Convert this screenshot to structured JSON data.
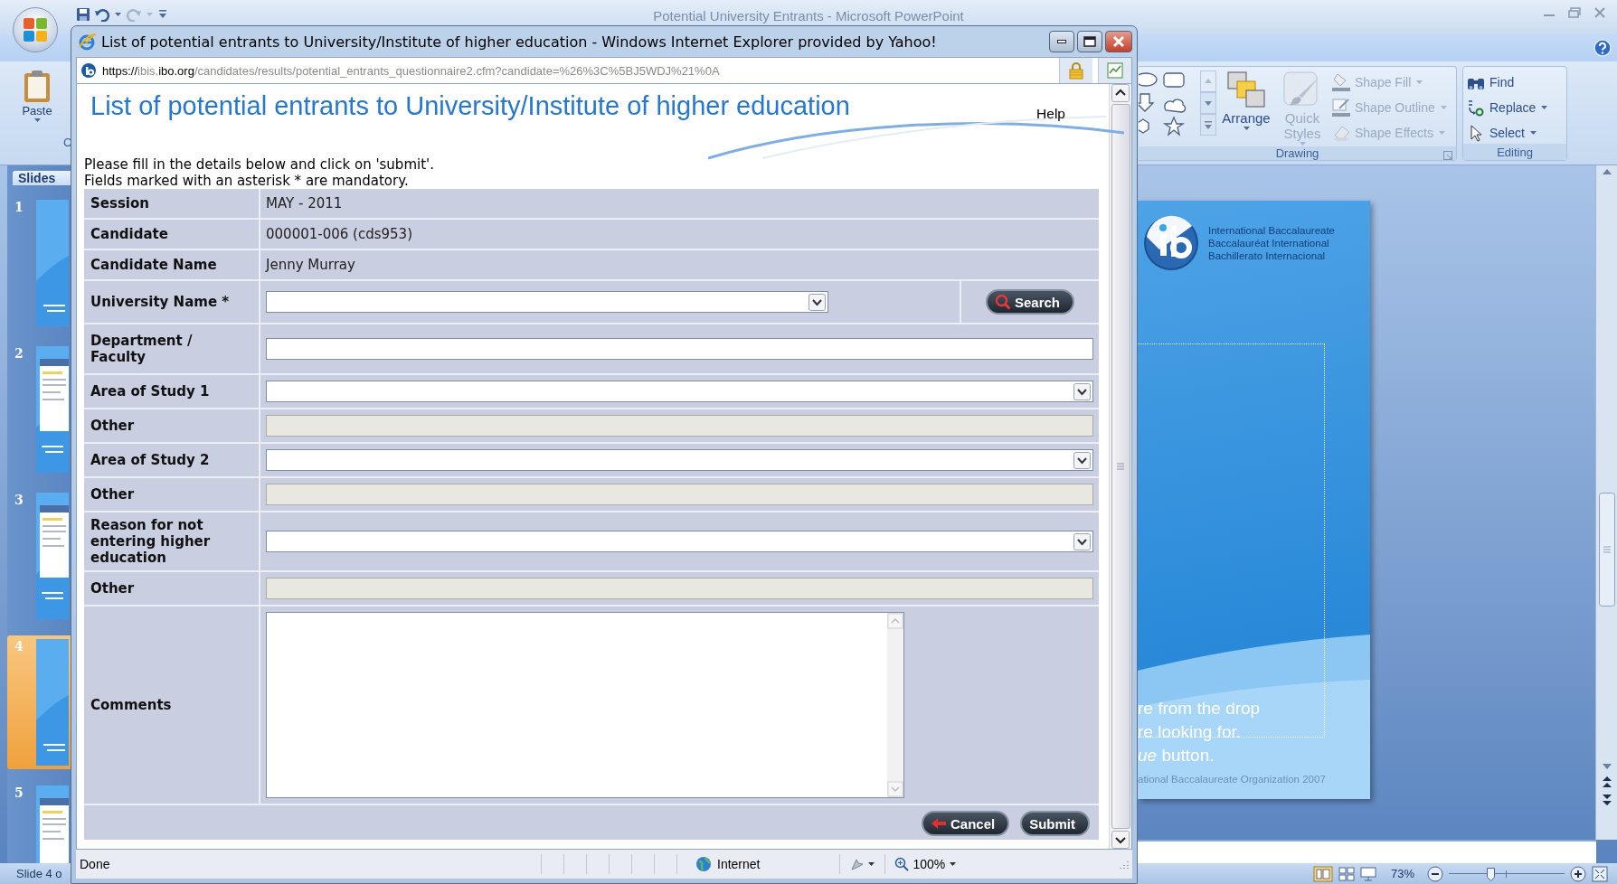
{
  "powerpoint": {
    "title": "Potential University Entrants - Microsoft PowerPoint",
    "ribbon": {
      "clipboard": {
        "paste_label": "Paste",
        "group_label": "C"
      },
      "drawing": {
        "large_buttons": [
          {
            "kind": "arrange",
            "label": "Arrange",
            "disabled": false
          },
          {
            "kind": "quick_styles",
            "label": "Quick Styles",
            "disabled": true
          }
        ],
        "commands": [
          {
            "kind": "fill",
            "label": "Shape Fill",
            "disabled": true
          },
          {
            "kind": "outline",
            "label": "Shape Outline",
            "disabled": true
          },
          {
            "kind": "effects",
            "label": "Shape Effects",
            "disabled": true
          }
        ],
        "group_label": "Drawing"
      },
      "editing": {
        "commands": [
          {
            "kind": "find",
            "label": "Find",
            "has_menu": false
          },
          {
            "kind": "replace",
            "label": "Replace",
            "has_menu": true
          },
          {
            "kind": "select",
            "label": "Select",
            "has_menu": true
          }
        ],
        "group_label": "Editing"
      }
    },
    "slides_pane": {
      "tab": "Slides",
      "thumbnails": [
        {
          "number": "1",
          "kind": "title",
          "selected": false
        },
        {
          "number": "2",
          "kind": "screenshot",
          "selected": false
        },
        {
          "number": "3",
          "kind": "screenshot",
          "selected": false
        },
        {
          "number": "4",
          "kind": "title",
          "selected": true
        },
        {
          "number": "5",
          "kind": "screenshot",
          "selected": false
        }
      ]
    },
    "slide": {
      "logo_lines": [
        "International Baccalaureate",
        "Baccalauréat International",
        "Bachillerato Internacional"
      ],
      "body_lines": [
        "re from the drop",
        "re looking for.",
        "*ue* button."
      ],
      "footer": "ational Baccalaureate Organization 2007"
    },
    "status_bar": {
      "slide_indicator": "Slide 4 o",
      "zoom": "73%",
      "zoom_slider": {
        "level": 0.36
      }
    }
  },
  "browser": {
    "title": "List of potential entrants to University/Institute of higher education - Windows Internet Explorer provided by Yahoo!",
    "address": "**https://**ibis.**ibo.org**/candidates/results/potential_entrants_questionnaire2.cfm?candidate=%26%3C%5BJ5WDJ%21%0A",
    "page": {
      "heading": "List of potential entrants to University/Institute of higher education",
      "help_link": "Help",
      "instructions": [
        "Please fill in the details below and click on 'submit'.",
        "Fields marked with an asterisk * are mandatory."
      ],
      "form_rows": [
        {
          "label": "Session",
          "kind": "text",
          "value": "MAY - 2011"
        },
        {
          "label": "Candidate",
          "kind": "text",
          "value": "000001-006 (cds953)"
        },
        {
          "label": "Candidate Name",
          "kind": "text",
          "value": "Jenny Murray"
        },
        {
          "label": "University Name *",
          "kind": "select",
          "disabled": false,
          "button": "Search"
        },
        {
          "label": "Department / Faculty",
          "kind": "input",
          "disabled": false
        },
        {
          "label": "Area of Study 1",
          "kind": "select",
          "disabled": false
        },
        {
          "label": "Other",
          "kind": "input",
          "disabled": true
        },
        {
          "label": "Area of Study 2",
          "kind": "select",
          "disabled": false
        },
        {
          "label": "Other",
          "kind": "input",
          "disabled": true
        },
        {
          "label": "Reason for not entering higher education",
          "kind": "select",
          "disabled": false
        },
        {
          "label": "Other",
          "kind": "input",
          "disabled": true
        },
        {
          "label": "Comments",
          "kind": "textarea",
          "disabled": false
        }
      ],
      "buttons": [
        {
          "kind": "cancel",
          "label": "Cancel"
        },
        {
          "kind": "submit",
          "label": "Submit"
        }
      ]
    },
    "status_bar": {
      "status": "Done",
      "zone": "Internet",
      "zoom": "100%"
    }
  }
}
